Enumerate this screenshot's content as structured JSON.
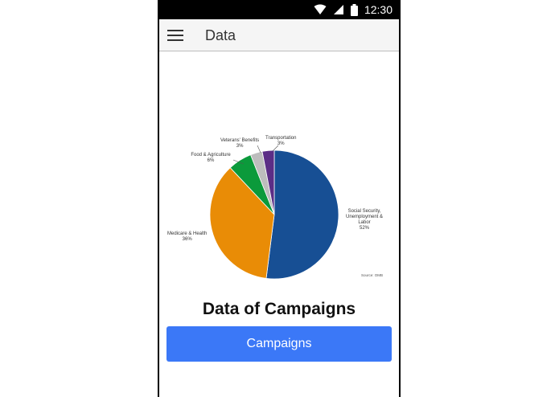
{
  "status_bar": {
    "time": "12:30",
    "icons": [
      "wifi-icon",
      "signal-icon",
      "battery-icon"
    ]
  },
  "app_bar": {
    "menu_icon": "hamburger-menu-icon",
    "title": "Data"
  },
  "chart_data": {
    "type": "pie",
    "title": "",
    "slices": [
      {
        "label": [
          "Social Security,",
          "Unemployment &",
          "Labor"
        ],
        "value": 52,
        "display": "52%",
        "color": "#174f94"
      },
      {
        "label": [
          "Medicare & Health"
        ],
        "value": 36,
        "display": "36%",
        "color": "#e98c06"
      },
      {
        "label": [
          "Food & Agriculture"
        ],
        "value": 6,
        "display": "6%",
        "color": "#0b9a3b"
      },
      {
        "label": [
          "Veterans' Benefits"
        ],
        "value": 3,
        "display": "3%",
        "color": "#bdbdbd"
      },
      {
        "label": [
          "Transportation"
        ],
        "value": 3,
        "display": "3%",
        "color": "#5b2d86"
      }
    ],
    "source": "Source: OMB"
  },
  "main": {
    "heading": "Data of Campaigns",
    "button_label": "Campaigns"
  },
  "colors": {
    "button": "#3b78f7",
    "app_bar": "#f5f5f5",
    "status_bar": "#000000"
  }
}
